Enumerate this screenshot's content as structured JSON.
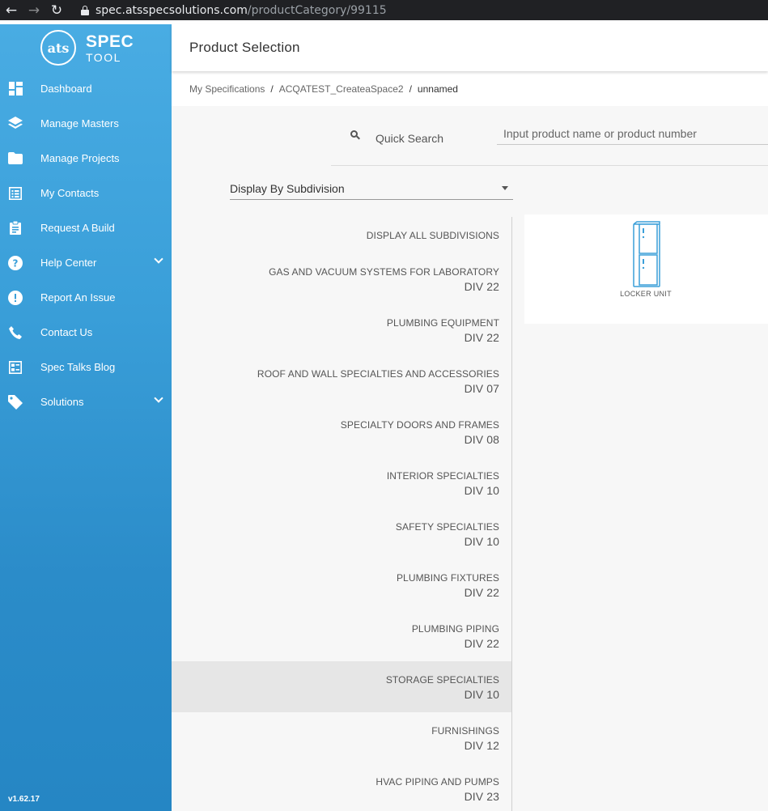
{
  "browser": {
    "url_host": "spec.atsspecsolutions.com",
    "url_path": "/productCategory/99115"
  },
  "sidebar": {
    "logo": {
      "mark": "ats",
      "title": "SPEC",
      "subtitle": "TOOL"
    },
    "items": [
      {
        "label": "Dashboard",
        "icon": "dashboard-icon"
      },
      {
        "label": "Manage Masters",
        "icon": "layers-icon"
      },
      {
        "label": "Manage Projects",
        "icon": "folder-icon"
      },
      {
        "label": "My Contacts",
        "icon": "contacts-list-icon"
      },
      {
        "label": "Request A Build",
        "icon": "clipboard-icon"
      },
      {
        "label": "Help Center",
        "icon": "question-icon"
      },
      {
        "label": "Report An Issue",
        "icon": "alert-icon"
      },
      {
        "label": "Contact Us",
        "icon": "phone-icon"
      },
      {
        "label": "Spec Talks Blog",
        "icon": "blog-icon"
      },
      {
        "label": "Solutions",
        "icon": "tag-icon"
      }
    ],
    "version": "v1.62.17"
  },
  "header": {
    "title": "Product Selection"
  },
  "breadcrumb": {
    "items": [
      "My Specifications",
      "ACQATEST_CreateaSpace2",
      "unnamed"
    ],
    "separator": "/"
  },
  "search": {
    "label": "Quick Search",
    "placeholder": "Input product name or product number"
  },
  "display_select": {
    "value": "Display By Subdivision"
  },
  "subdivisions": {
    "display_all": "DISPLAY ALL SUBDIVISIONS",
    "items": [
      {
        "name": "GAS AND VACUUM SYSTEMS FOR LABORATORY",
        "div": "DIV 22"
      },
      {
        "name": "PLUMBING EQUIPMENT",
        "div": "DIV 22"
      },
      {
        "name": "ROOF AND WALL SPECIALTIES AND ACCESSORIES",
        "div": "DIV 07"
      },
      {
        "name": "SPECIALTY DOORS AND FRAMES",
        "div": "DIV 08"
      },
      {
        "name": "INTERIOR SPECIALTIES",
        "div": "DIV 10"
      },
      {
        "name": "SAFETY SPECIALTIES",
        "div": "DIV 10"
      },
      {
        "name": "PLUMBING FIXTURES",
        "div": "DIV 22"
      },
      {
        "name": "PLUMBING PIPING",
        "div": "DIV 22"
      },
      {
        "name": "STORAGE SPECIALTIES",
        "div": "DIV 10",
        "selected": true
      },
      {
        "name": "FURNISHINGS",
        "div": "DIV 12"
      },
      {
        "name": "HVAC PIPING AND PUMPS",
        "div": "DIV 23"
      }
    ]
  },
  "products": [
    {
      "name": "LOCKER UNIT",
      "icon": "locker-icon"
    }
  ],
  "colors": {
    "sidebar_top": "#49ace3",
    "sidebar_bottom": "#2586c4",
    "locker": "#3a9fd9",
    "selected_row": "#e6e6e6"
  }
}
